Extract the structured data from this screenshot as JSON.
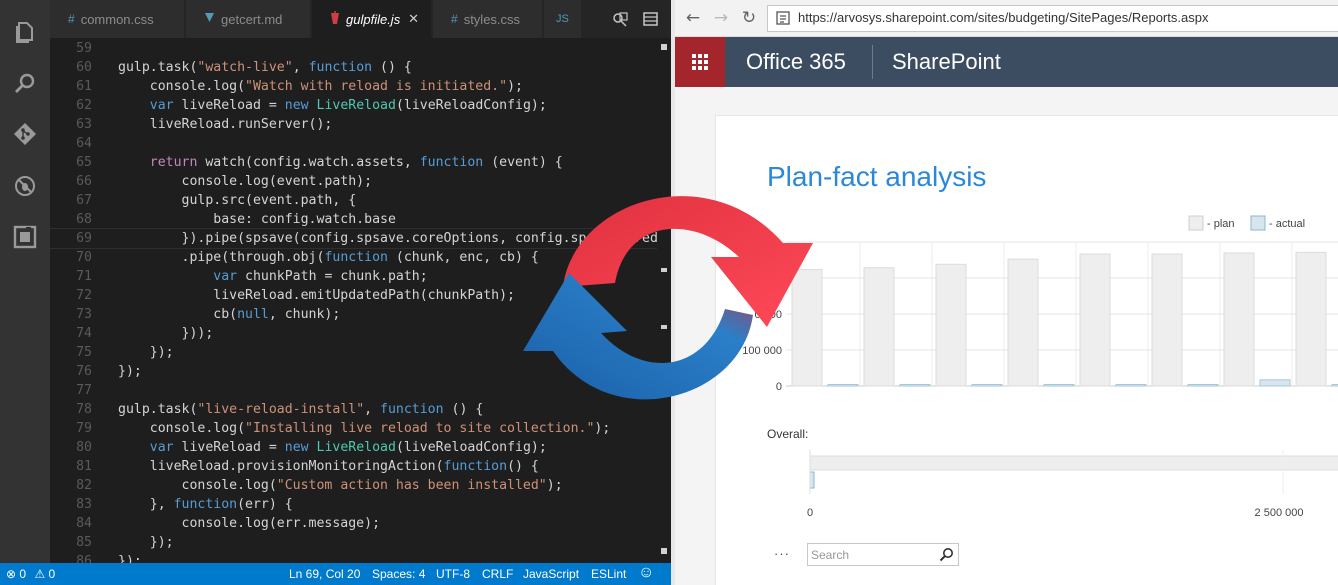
{
  "editor": {
    "tabs": [
      {
        "label": "common.css",
        "glyph": "#",
        "glyph_color": "#519aba"
      },
      {
        "label": "getcert.md",
        "glyph": "▼",
        "glyph_color": "#519aba"
      },
      {
        "label": "gulpfile.js",
        "glyph": "●",
        "glyph_color": "#cc3e44",
        "close": "✕"
      },
      {
        "label": "styles.css",
        "glyph": "#",
        "glyph_color": "#519aba"
      },
      {
        "label": "JS",
        "glyph": "",
        "glyph_color": "#519aba"
      }
    ],
    "activity_icons": [
      "files-icon",
      "search-icon",
      "git-icon",
      "debug-icon",
      "extensions-icon"
    ],
    "lines": [
      {
        "n": "59",
        "tokens": []
      },
      {
        "n": "60",
        "tokens": [
          [
            "gulp.task(",
            "p"
          ],
          [
            "\"watch-live\"",
            "s"
          ],
          [
            ", ",
            "p"
          ],
          [
            "function",
            "k"
          ],
          [
            " () {",
            "p"
          ]
        ]
      },
      {
        "n": "61",
        "tokens": [
          [
            "    console.log(",
            "p"
          ],
          [
            "\"Watch with reload is initiated.\"",
            "s"
          ],
          [
            ");",
            "p"
          ]
        ]
      },
      {
        "n": "62",
        "tokens": [
          [
            "    ",
            "p"
          ],
          [
            "var",
            "k"
          ],
          [
            " liveReload = ",
            "p"
          ],
          [
            "new",
            "k"
          ],
          [
            " ",
            "p"
          ],
          [
            "LiveReload",
            "t"
          ],
          [
            "(liveReloadConfig);",
            "p"
          ]
        ]
      },
      {
        "n": "63",
        "tokens": [
          [
            "    liveReload.runServer();",
            "p"
          ]
        ]
      },
      {
        "n": "64",
        "tokens": []
      },
      {
        "n": "65",
        "tokens": [
          [
            "    ",
            "p"
          ],
          [
            "return",
            "c"
          ],
          [
            " watch(config.watch.assets, ",
            "p"
          ],
          [
            "function",
            "k"
          ],
          [
            " (event) {",
            "p"
          ]
        ]
      },
      {
        "n": "66",
        "tokens": [
          [
            "        console.log(event.path);",
            "p"
          ]
        ]
      },
      {
        "n": "67",
        "tokens": [
          [
            "        gulp.src(event.path, {",
            "p"
          ]
        ]
      },
      {
        "n": "68",
        "tokens": [
          [
            "            base: config.watch.base",
            "p"
          ]
        ]
      },
      {
        "n": "69",
        "tokens": [
          [
            "        }).pipe(spsave(config.spsave.coreOptions, config.spsave.creds))",
            "p"
          ]
        ]
      },
      {
        "n": "70",
        "tokens": [
          [
            "        .pipe(through.obj(",
            "p"
          ],
          [
            "function",
            "k"
          ],
          [
            " (chunk, enc, cb) {",
            "p"
          ]
        ]
      },
      {
        "n": "71",
        "tokens": [
          [
            "            ",
            "p"
          ],
          [
            "var",
            "k"
          ],
          [
            " chunkPath = chunk.path;",
            "p"
          ]
        ]
      },
      {
        "n": "72",
        "tokens": [
          [
            "            liveReload.emitUpdatedPath(chunkPath);",
            "p"
          ]
        ]
      },
      {
        "n": "73",
        "tokens": [
          [
            "            cb(",
            "p"
          ],
          [
            "null",
            "k"
          ],
          [
            ", chunk);",
            "p"
          ]
        ]
      },
      {
        "n": "74",
        "tokens": [
          [
            "        }));",
            "p"
          ]
        ]
      },
      {
        "n": "75",
        "tokens": [
          [
            "    });",
            "p"
          ]
        ]
      },
      {
        "n": "76",
        "tokens": [
          [
            "});",
            "p"
          ]
        ]
      },
      {
        "n": "77",
        "tokens": []
      },
      {
        "n": "78",
        "tokens": [
          [
            "gulp.task(",
            "p"
          ],
          [
            "\"live-reload-install\"",
            "s"
          ],
          [
            ", ",
            "p"
          ],
          [
            "function",
            "k"
          ],
          [
            " () {",
            "p"
          ]
        ]
      },
      {
        "n": "79",
        "tokens": [
          [
            "    console.log(",
            "p"
          ],
          [
            "\"Installing live reload to site collection.\"",
            "s"
          ],
          [
            ");",
            "p"
          ]
        ]
      },
      {
        "n": "80",
        "tokens": [
          [
            "    ",
            "p"
          ],
          [
            "var",
            "k"
          ],
          [
            " liveReload = ",
            "p"
          ],
          [
            "new",
            "k"
          ],
          [
            " ",
            "p"
          ],
          [
            "LiveReload",
            "t"
          ],
          [
            "(liveReloadConfig);",
            "p"
          ]
        ]
      },
      {
        "n": "81",
        "tokens": [
          [
            "    liveReload.provisionMonitoringAction(",
            "p"
          ],
          [
            "function",
            "k"
          ],
          [
            "() {",
            "p"
          ]
        ]
      },
      {
        "n": "82",
        "tokens": [
          [
            "        console.log(",
            "p"
          ],
          [
            "\"Custom action has been installed\"",
            "s"
          ],
          [
            ");",
            "p"
          ]
        ]
      },
      {
        "n": "83",
        "tokens": [
          [
            "    }, ",
            "p"
          ],
          [
            "function",
            "k"
          ],
          [
            "(err) {",
            "p"
          ]
        ]
      },
      {
        "n": "84",
        "tokens": [
          [
            "        console.log(err.message);",
            "p"
          ]
        ]
      },
      {
        "n": "85",
        "tokens": [
          [
            "    });",
            "p"
          ]
        ]
      },
      {
        "n": "86",
        "tokens": [
          [
            "});",
            "p"
          ]
        ]
      }
    ],
    "current_line": "69",
    "token_colors": {
      "p": "#d4d4d4",
      "s": "#ce9178",
      "k": "#569cd6",
      "c": "#c586c0",
      "t": "#4ec9b0"
    }
  },
  "status": {
    "errors": "0",
    "warnings": "0",
    "position": "Ln 69, Col 20",
    "spaces": "Spaces: 4",
    "encoding": "UTF-8",
    "eol": "CRLF",
    "language": "JavaScript",
    "linter": "ESLint",
    "smiley": "☺"
  },
  "browser": {
    "url": "https://arvosys.sharepoint.com/sites/budgeting/SitePages/Reports.aspx",
    "suite_title": "Office 365",
    "app_title": "SharePoint",
    "page_title": "Plan-fact analysis",
    "overall_label": "Overall:",
    "more": "···",
    "search_placeholder": "Search"
  },
  "chart_data": [
    {
      "type": "bar",
      "legend": [
        "- plan",
        "- actual"
      ],
      "legend_position": "top-right",
      "y_tick_labels": [
        "0 000",
        "0 000",
        "100 000",
        "0"
      ],
      "series": [
        {
          "name": "plan",
          "values": [
            340000,
            345000,
            355000,
            370000,
            385000,
            385000,
            388000,
            390000
          ]
        },
        {
          "name": "actual",
          "values": [
            1000,
            1000,
            1000,
            1000,
            1000,
            1000,
            18000,
            1000
          ]
        }
      ],
      "ylim": [
        0,
        420000
      ],
      "colors": {
        "plan": "#eeeeee",
        "actual": "#d7e6ee"
      }
    },
    {
      "type": "bar",
      "orientation": "horizontal",
      "title": "Overall:",
      "x_tick_labels": [
        "0",
        "2 500 000"
      ],
      "series": [
        {
          "name": "plan",
          "values": [
            3000000
          ]
        },
        {
          "name": "actual",
          "values": [
            20000
          ]
        }
      ],
      "xlim": [
        0,
        2950000
      ]
    }
  ],
  "colors": {
    "suite_bar": "#3c4c61",
    "app_launcher": "#a4262c",
    "accent_blue": "#2b88d8",
    "status_bar": "#007acc",
    "sync_red": "#ee3344",
    "sync_blue": "#1e6fb5"
  }
}
